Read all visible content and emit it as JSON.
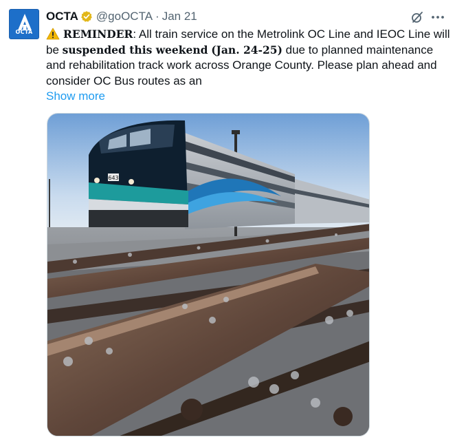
{
  "tweet": {
    "display_name": "OCTA",
    "handle": "@goOCTA",
    "separator": "·",
    "date": "Jan 21",
    "avatar_text": "OCTA",
    "verified_icon": "verified-badge-icon",
    "body": {
      "reminder_label": "REMINDER",
      "part1": ": All train service on the Metrolink OC Line and IEOC Line will be ",
      "emphasis1": "suspended this weekend",
      "part2": " ",
      "emphasis2": "(Jan. 24-25)",
      "part3": " due to planned maintenance and rehabilitation track work across Orange County. Please plan ahead and consider OC Bus routes as an"
    },
    "show_more": "Show more",
    "train_number": "643",
    "colors": {
      "link": "#1d9bf0",
      "brand": "#1d6fc9",
      "verified": "#e2b719",
      "text": "#0f1419",
      "muted": "#536471"
    }
  }
}
